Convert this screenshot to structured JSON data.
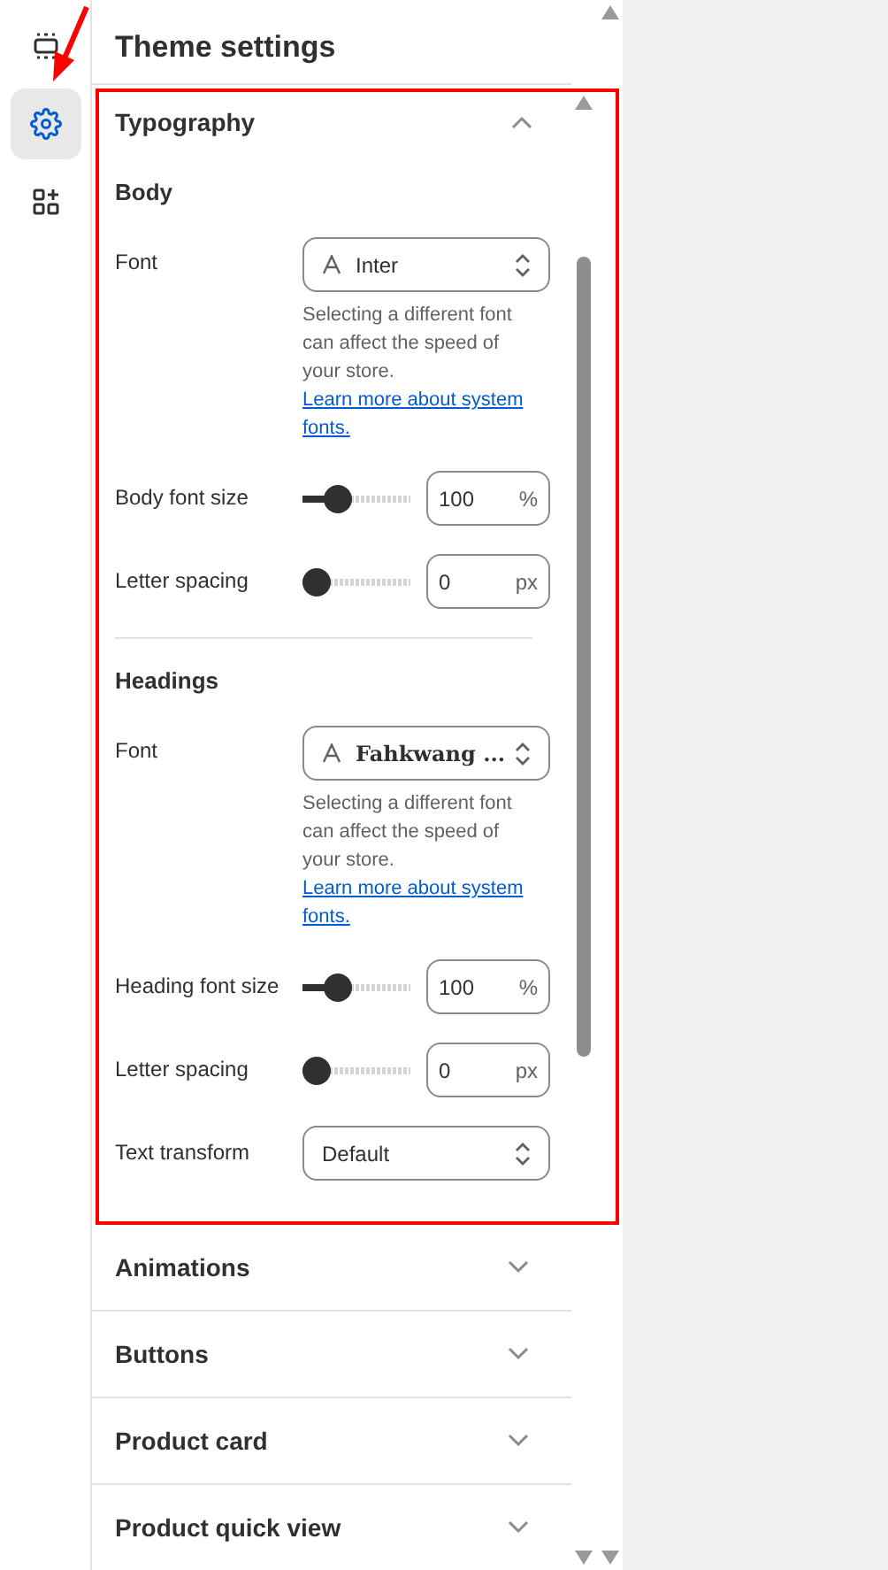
{
  "rail": [
    {
      "kind": "sections",
      "selected": false
    },
    {
      "kind": "settings",
      "selected": true
    },
    {
      "kind": "apps",
      "selected": false
    }
  ],
  "panel": {
    "title": "Theme settings"
  },
  "typography": {
    "title": "Typography",
    "expanded": true,
    "groups": [
      {
        "heading": "Body",
        "fields": [
          {
            "kind": "font",
            "label": "Font",
            "value": "Inter",
            "help": "Selecting a different font can affect the speed of your store.",
            "link": "Learn more about system fonts."
          },
          {
            "kind": "slider",
            "label": "Body font size",
            "level": 0.27,
            "value": "100",
            "unit": "%"
          },
          {
            "kind": "slider",
            "label": "Letter spacing",
            "level": 0,
            "value": "0",
            "unit": "px"
          }
        ]
      },
      {
        "heading": "Headings",
        "fields": [
          {
            "kind": "font",
            "label": "Font",
            "value": "Fahkwang ...",
            "help": "Selecting a different font can affect the speed of your store.",
            "link": "Learn more about system fonts."
          },
          {
            "kind": "slider",
            "label": "Heading font size",
            "level": 0.27,
            "value": "100",
            "unit": "%"
          },
          {
            "kind": "slider",
            "label": "Letter spacing",
            "level": 0,
            "value": "0",
            "unit": "px"
          },
          {
            "kind": "select",
            "label": "Text transform",
            "value": "Default"
          }
        ]
      }
    ]
  },
  "sections": [
    {
      "title": "Animations",
      "expanded": false
    },
    {
      "title": "Buttons",
      "expanded": false
    },
    {
      "title": "Product card",
      "expanded": false
    },
    {
      "title": "Product quick view",
      "expanded": false
    }
  ],
  "annotation": {
    "highlight_frame": true,
    "pointer_arrow": true
  }
}
